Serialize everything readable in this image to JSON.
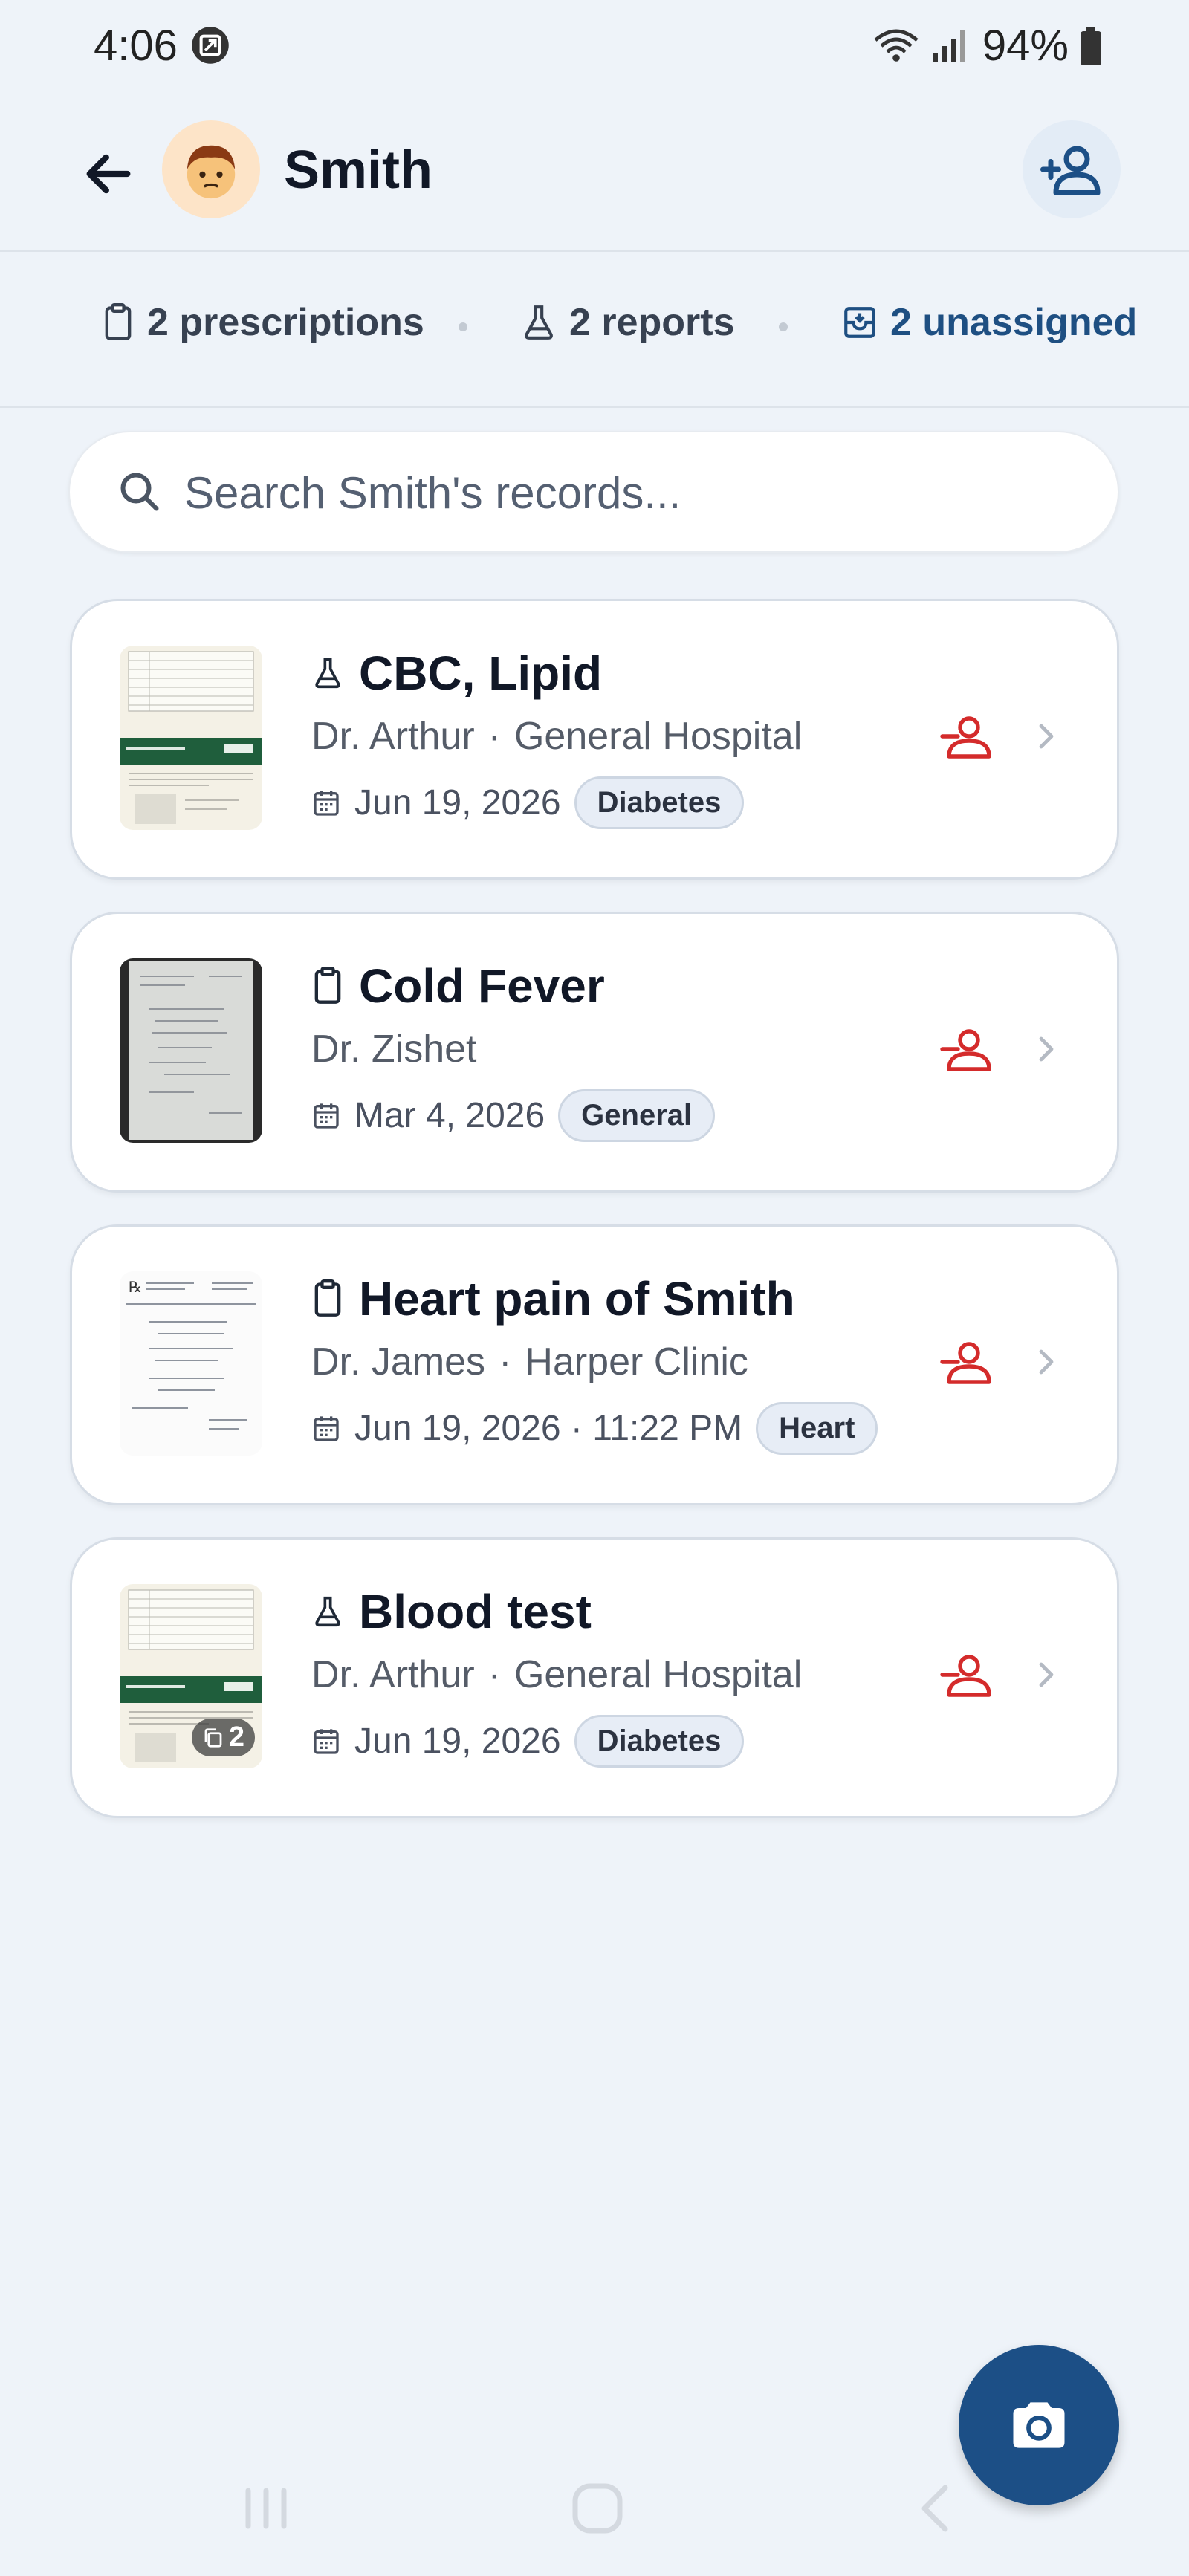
{
  "status_bar": {
    "time": "4:06",
    "battery": "94%"
  },
  "header": {
    "title": "Smith",
    "avatar_emoji": "👦"
  },
  "stats": {
    "prescriptions": "2 prescriptions",
    "reports": "2 reports",
    "unassigned": "2 unassigned"
  },
  "search": {
    "placeholder": "Search Smith's records..."
  },
  "records": [
    {
      "type": "report",
      "title": "CBC, Lipid",
      "doctor": "Dr. Arthur",
      "facility": "General Hospital",
      "date": "Jun 19, 2026",
      "tag": "Diabetes"
    },
    {
      "type": "prescription",
      "title": "Cold Fever",
      "doctor": "Dr. Zishet",
      "facility": "",
      "date": "Mar 4, 2026",
      "tag": "General"
    },
    {
      "type": "prescription",
      "title": "Heart pain of Smith",
      "doctor": "Dr. James",
      "facility": "Harper Clinic",
      "date": "Jun 19, 2026 · 11:22 PM",
      "tag": "Heart"
    },
    {
      "type": "report",
      "title": "Blood test",
      "doctor": "Dr. Arthur",
      "facility": "General Hospital",
      "date": "Jun 19, 2026",
      "tag": "Diabetes",
      "page_count": "2"
    }
  ],
  "colors": {
    "accent": "#1c4f86",
    "unassign": "#d42b2b",
    "background": "#eef3f9"
  }
}
